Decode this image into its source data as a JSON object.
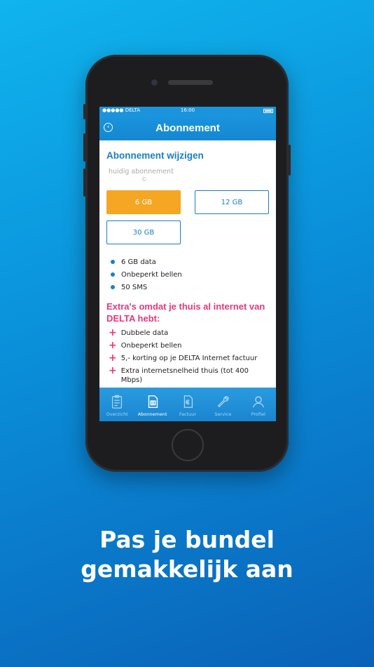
{
  "status_bar": {
    "carrier": "●●●●● DELTA",
    "time": "16:00"
  },
  "navbar": {
    "title": "Abonnement"
  },
  "content": {
    "heading": "Abonnement wijzigen",
    "current_label": "huidig abonnement",
    "current_mark": "©",
    "plans": [
      {
        "label": "6 GB",
        "selected": true
      },
      {
        "label": "12 GB",
        "selected": false
      },
      {
        "label": "30 GB",
        "selected": false
      }
    ],
    "features": [
      "6 GB data",
      "Onbeperkt bellen",
      "50 SMS"
    ],
    "extra_title": "Extra's omdat je thuis al internet van DELTA hebt:",
    "extras": [
      "Dubbele data",
      "Onbeperkt bellen",
      "5,- korting op je DELTA Internet factuur",
      "Extra internetsnelheid thuis (tot 400 Mbps)"
    ]
  },
  "tabbar": {
    "tabs": [
      {
        "label": "Overzicht",
        "icon": "clipboard-icon",
        "active": false
      },
      {
        "label": "Abonnement",
        "icon": "sim-card-icon",
        "active": true
      },
      {
        "label": "Factuur",
        "icon": "invoice-icon",
        "active": false
      },
      {
        "label": "Service",
        "icon": "wrench-icon",
        "active": false
      },
      {
        "label": "Profiel",
        "icon": "profile-icon",
        "active": false
      }
    ]
  },
  "tagline": {
    "line1": "Pas je bundel",
    "line2": "gemakkelijk aan"
  },
  "colors": {
    "brand_blue": "#1a7fc4",
    "accent_orange": "#f5a623",
    "accent_pink": "#e5387a"
  }
}
